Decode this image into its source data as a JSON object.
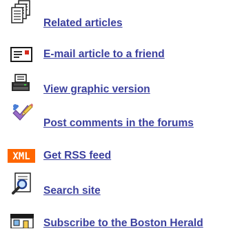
{
  "colors": {
    "link": "#3a3f9e",
    "rss_badge_bg": "#ff6600"
  },
  "links": [
    {
      "label": "Related articles",
      "icon": "stacked-documents-icon"
    },
    {
      "label": "E-mail article to a friend",
      "icon": "email-card-icon"
    },
    {
      "label": "View graphic version",
      "icon": "printer-icon"
    },
    {
      "label": "Post comments in the forums",
      "icon": "pencil-checkmark-icon"
    },
    {
      "label": "Get RSS feed",
      "icon": "xml-badge-icon",
      "badge_text": "XML"
    },
    {
      "label": "Search site",
      "icon": "search-page-icon"
    },
    {
      "label": "Subscribe to the Boston Herald",
      "icon": "storefront-icon"
    }
  ]
}
